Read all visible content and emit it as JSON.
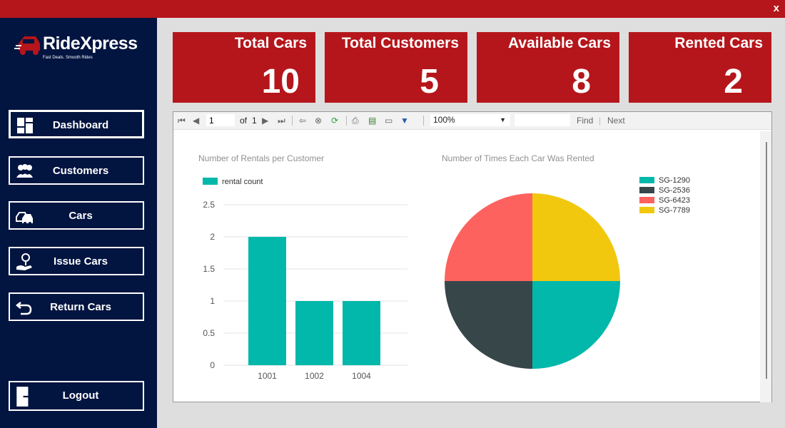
{
  "window": {
    "close_label": "x"
  },
  "logo": {
    "name": "RideXpress",
    "tagline": "Fast Deals. Smooth Rides"
  },
  "nav": [
    {
      "label": "Dashboard",
      "icon": "dashboard-icon"
    },
    {
      "label": "Customers",
      "icon": "customers-icon"
    },
    {
      "label": "Cars",
      "icon": "cars-icon"
    },
    {
      "label": "Issue Cars",
      "icon": "issue-key-icon"
    },
    {
      "label": "Return Cars",
      "icon": "return-arrow-icon"
    },
    {
      "label": "Logout",
      "icon": "logout-icon"
    }
  ],
  "stats": [
    {
      "title": "Total Cars",
      "value": "10"
    },
    {
      "title": "Total Customers",
      "value": "5"
    },
    {
      "title": "Available Cars",
      "value": "8"
    },
    {
      "title": "Rented Cars",
      "value": "2"
    }
  ],
  "toolbar": {
    "page": "1",
    "of_label": "of",
    "total_pages": "1",
    "zoom": "100%",
    "find_label": "Find",
    "sep": "|",
    "next_label": "Next"
  },
  "colors": {
    "sidebar": "#021440",
    "accent": "#b5161b",
    "teal": "#01b8aa",
    "dark": "#374649",
    "salmon": "#fd625e",
    "yellow": "#f2c80f"
  },
  "chart_data": [
    {
      "type": "bar",
      "title": "Number of Rentals per Customer",
      "categories": [
        "1001",
        "1002",
        "1004"
      ],
      "series": [
        {
          "name": "rental count",
          "values": [
            2,
            1,
            1
          ]
        }
      ],
      "ylim": [
        0,
        2.5
      ],
      "yticks": [
        "0",
        "0.5",
        "1",
        "1.5",
        "2",
        "2.5"
      ],
      "grid": true,
      "legend": "top-left"
    },
    {
      "type": "pie",
      "title": "Number of Times Each Car Was Rented",
      "labels": [
        "SG-1290",
        "SG-2536",
        "SG-6423",
        "SG-7789"
      ],
      "values": [
        1,
        1,
        1,
        1
      ],
      "legend": "top-right"
    }
  ]
}
